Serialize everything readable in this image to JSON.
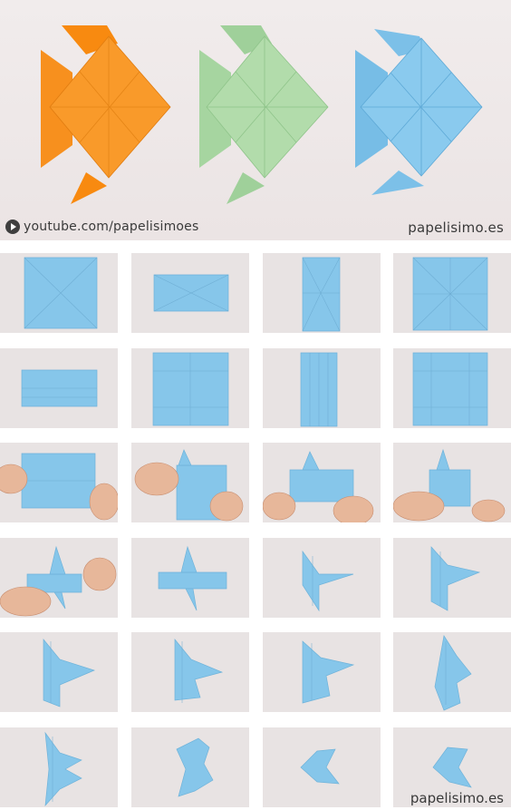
{
  "credits": {
    "youtube": "youtube.com/papelisimoes",
    "site": "papelisimo.es",
    "site_bottom": "papelisimo.es"
  },
  "colors": {
    "orange_fish": "#f7901e",
    "green_fish": "#a8d6a2",
    "blue_paper": "#86c6ea"
  },
  "steps_count": 24
}
